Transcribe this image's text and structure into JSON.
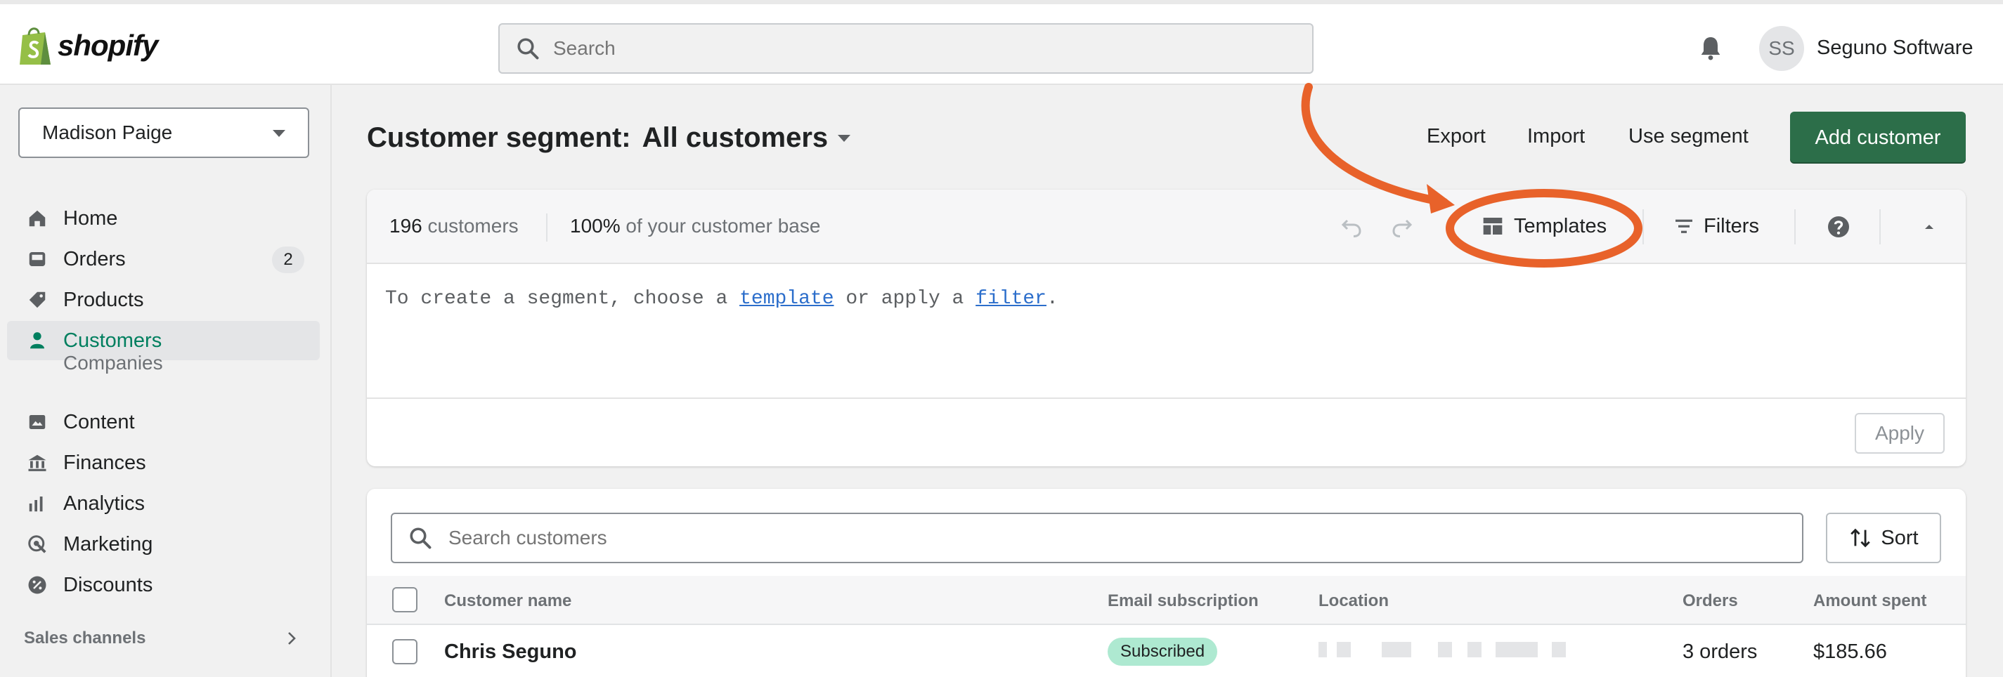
{
  "topbar": {
    "brand": "shopify",
    "search_placeholder": "Search",
    "avatar_initials": "SS",
    "store_name": "Seguno Software"
  },
  "sidebar": {
    "store_selector": "Madison Paige",
    "items": [
      {
        "label": "Home",
        "icon": "home-icon"
      },
      {
        "label": "Orders",
        "icon": "orders-icon",
        "badge": "2"
      },
      {
        "label": "Products",
        "icon": "tag-icon"
      },
      {
        "label": "Customers",
        "icon": "person-icon",
        "active": true
      },
      {
        "label": "Companies",
        "sub": true
      },
      {
        "label": "Content",
        "icon": "content-icon"
      },
      {
        "label": "Finances",
        "icon": "bank-icon"
      },
      {
        "label": "Analytics",
        "icon": "bar-chart-icon"
      },
      {
        "label": "Marketing",
        "icon": "target-icon"
      },
      {
        "label": "Discounts",
        "icon": "discount-icon"
      }
    ],
    "sales_channels": "Sales channels"
  },
  "header": {
    "title_prefix": "Customer segment:",
    "segment": "All customers",
    "actions": [
      "Export",
      "Import",
      "Use segment"
    ],
    "primary": "Add customer"
  },
  "segment_card": {
    "count_value": "196",
    "count_label": "customers",
    "pct_value": "100%",
    "pct_label": "of your customer base",
    "templates_label": "Templates",
    "filters_label": "Filters",
    "editor_prefix": "To create a segment, choose a ",
    "editor_link1": "template",
    "editor_mid": " or apply a ",
    "editor_link2": "filter",
    "editor_suffix": ".",
    "apply_label": "Apply"
  },
  "customers": {
    "search_placeholder": "Search customers",
    "sort_label": "Sort",
    "columns": [
      "Customer name",
      "Email subscription",
      "Location",
      "Orders",
      "Amount spent"
    ],
    "rows": [
      {
        "name": "Chris Seguno",
        "subscription": "Subscribed",
        "orders": "3 orders",
        "amount": "$185.66"
      }
    ]
  },
  "colors": {
    "accent": "#2c6e49",
    "active_nav": "#007f5f",
    "annotation": "#e8622a",
    "subscribed_pill": "#aee9d1"
  }
}
